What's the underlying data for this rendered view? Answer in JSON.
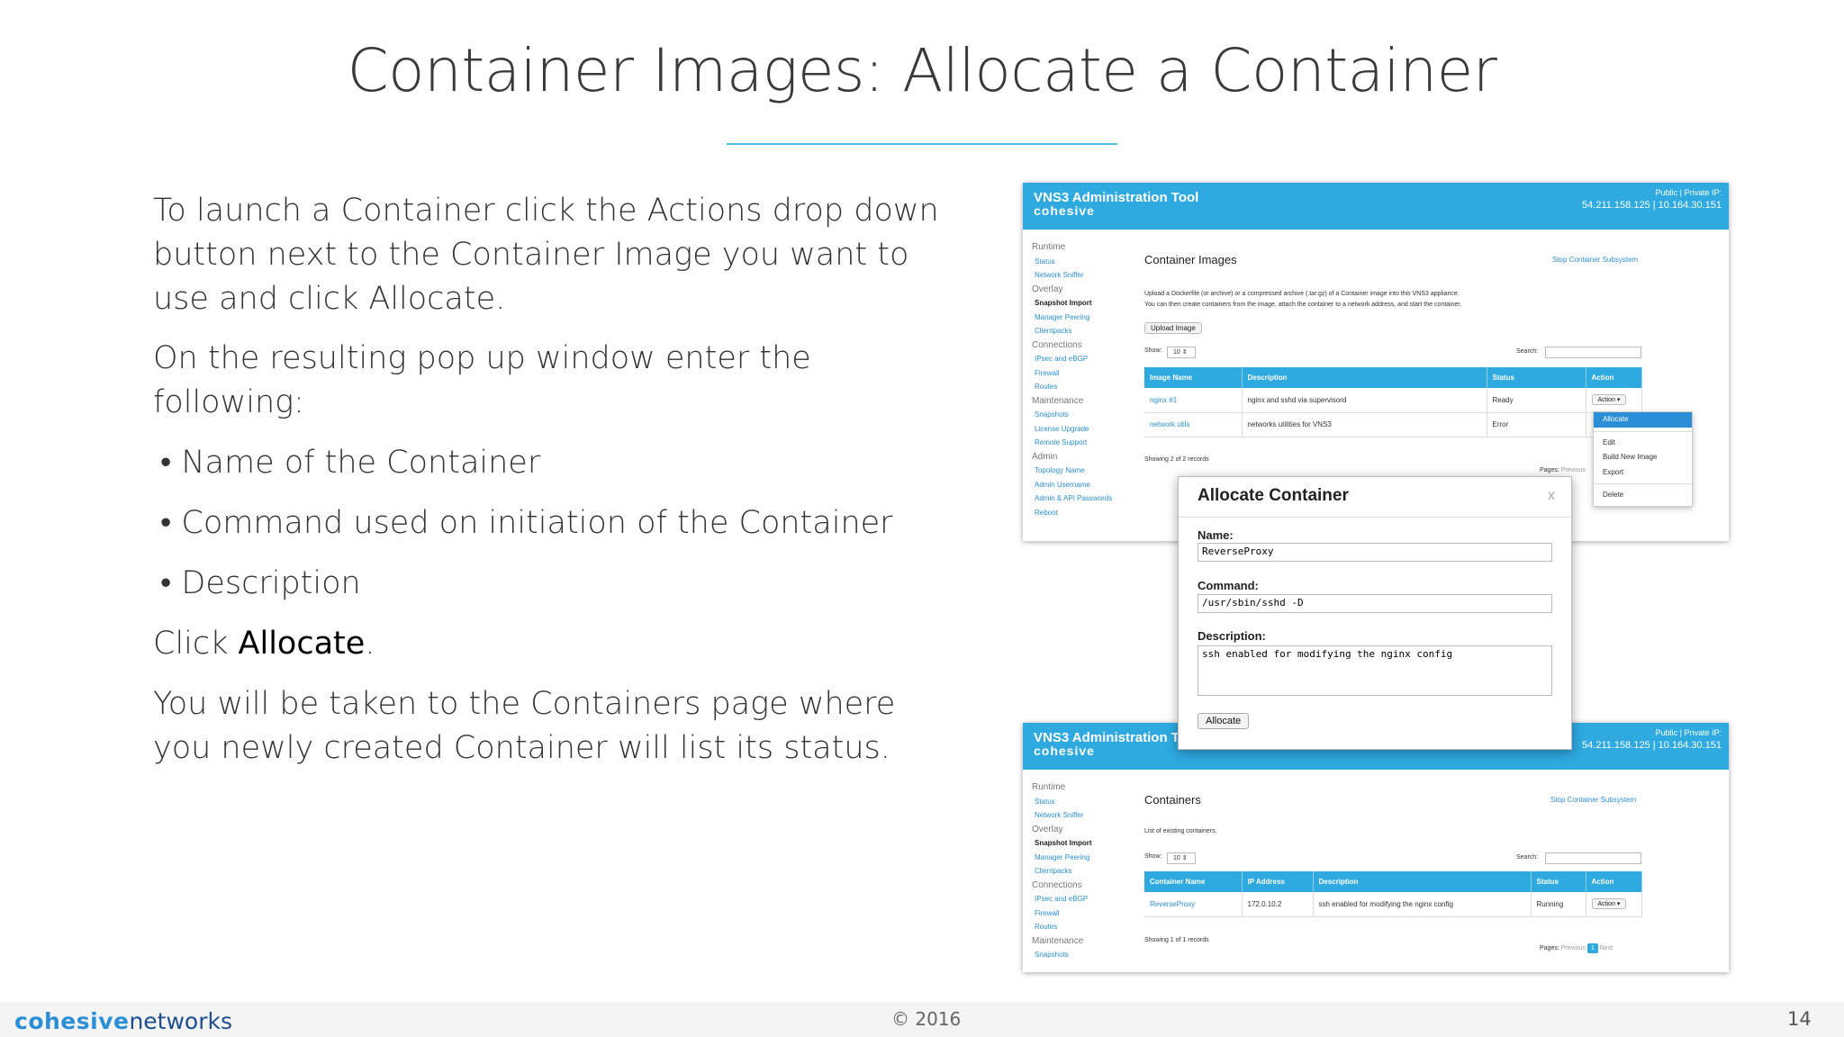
{
  "slide": {
    "title": "Container Images: Allocate a Container",
    "p1": "To launch a Container click the Actions drop down button next to the Container Image you want to use and click Allocate.",
    "p2": "On the resulting pop up window enter the following:",
    "bullets": [
      "• Name of the Container",
      "• Command used on initiation of the Container",
      "• Description"
    ],
    "p3_prefix": "Click ",
    "p3_bold": "Allocate",
    "p3_suffix": ".",
    "p4": "You will be taken to the Containers page where you newly created Container will list its status.",
    "footer": {
      "logo_bold": "cohesive",
      "logo_rest": "networks",
      "copyright": "© 2016",
      "page": "14"
    }
  },
  "shot1": {
    "app_title": "VNS3 Administration Tool",
    "logo": "cohesive",
    "ip_label": "Public | Private IP:",
    "ip_value": "54.211.158.125 | 10.164.30.151",
    "sidebar": [
      {
        "h": "Runtime",
        "items": [
          {
            "t": "Status"
          },
          {
            "t": "Network Sniffer"
          }
        ]
      },
      {
        "h": "Overlay",
        "items": [
          {
            "t": "Snapshot Import",
            "active": true
          },
          {
            "t": "Manager Peering"
          },
          {
            "t": "Clientpacks"
          }
        ]
      },
      {
        "h": "Connections",
        "items": [
          {
            "t": "IPsec and eBGP"
          },
          {
            "t": "Firewall"
          },
          {
            "t": "Routes"
          }
        ]
      },
      {
        "h": "Maintenance",
        "items": [
          {
            "t": "Snapshots"
          },
          {
            "t": "License Upgrade"
          },
          {
            "t": "Remote Support"
          }
        ]
      },
      {
        "h": "Admin",
        "items": [
          {
            "t": "Topology Name"
          },
          {
            "t": "Admin Username"
          },
          {
            "t": "Admin & API Passwords"
          },
          {
            "t": "Reboot"
          }
        ]
      }
    ],
    "page_title": "Container Images",
    "stop_link": "Stop Container Subsystem",
    "desc1": "Upload a Dockerfile (or archive) or a compressed archive (.tar.gz) of a Container image into this VNS3 appliance.",
    "desc2": "You can then create containers from the image, attach the container to a network address, and start the container.",
    "upload_btn": "Upload Image",
    "show_label": "Show:",
    "show_value": "10",
    "search_label": "Search:",
    "columns": [
      "Image Name",
      "Description",
      "Status",
      "Action"
    ],
    "rows": [
      {
        "name": "nginx #1",
        "desc": "nginx and sshd via supervisord",
        "status": "Ready",
        "action": "Action"
      },
      {
        "name": "network utils",
        "desc": "networks utilities for VNS3",
        "status": "Error",
        "action": ""
      }
    ],
    "showing": "Showing 2 of 2 records",
    "pages": "Pages:",
    "prev": "Previous",
    "menu": [
      "Allocate",
      "Edit",
      "Build New Image",
      "Export",
      "Delete"
    ]
  },
  "modal": {
    "title": "Allocate Container",
    "close": "x",
    "name_label": "Name:",
    "name_value": "ReverseProxy",
    "cmd_label": "Command:",
    "cmd_value": "/usr/sbin/sshd -D",
    "desc_label": "Description:",
    "desc_value": "ssh enabled for modifying the nginx config",
    "button": "Allocate"
  },
  "shot2": {
    "app_title": "VNS3 Administration Tool",
    "logo": "cohesive",
    "ip_label": "Public | Private IP:",
    "ip_value": "54.211.158.125 | 10.164.30.151",
    "sidebar": [
      {
        "h": "Runtime",
        "items": [
          {
            "t": "Status"
          },
          {
            "t": "Network Sniffer"
          }
        ]
      },
      {
        "h": "Overlay",
        "items": [
          {
            "t": "Snapshot Import",
            "active": true
          },
          {
            "t": "Manager Peering"
          },
          {
            "t": "Clientpacks"
          }
        ]
      },
      {
        "h": "Connections",
        "items": [
          {
            "t": "IPsec and eBGP"
          },
          {
            "t": "Firewall"
          },
          {
            "t": "Routes"
          }
        ]
      },
      {
        "h": "Maintenance",
        "items": [
          {
            "t": "Snapshots"
          }
        ]
      }
    ],
    "page_title": "Containers",
    "stop_link": "Stop Container Subsystem",
    "desc": "List of existing containers.",
    "show_label": "Show:",
    "show_value": "10",
    "search_label": "Search:",
    "columns": [
      "Container Name",
      "IP Address",
      "Description",
      "Status",
      "Action"
    ],
    "rows": [
      {
        "name": "ReverseProxy",
        "ip": "172.0.10.2",
        "desc": "ssh enabled for modifying the nginx config",
        "status": "Running",
        "action": "Action"
      }
    ],
    "showing": "Showing 1 of 1 records",
    "pages": "Pages:",
    "prev": "Previous",
    "page_num": "1",
    "next": "Next"
  }
}
